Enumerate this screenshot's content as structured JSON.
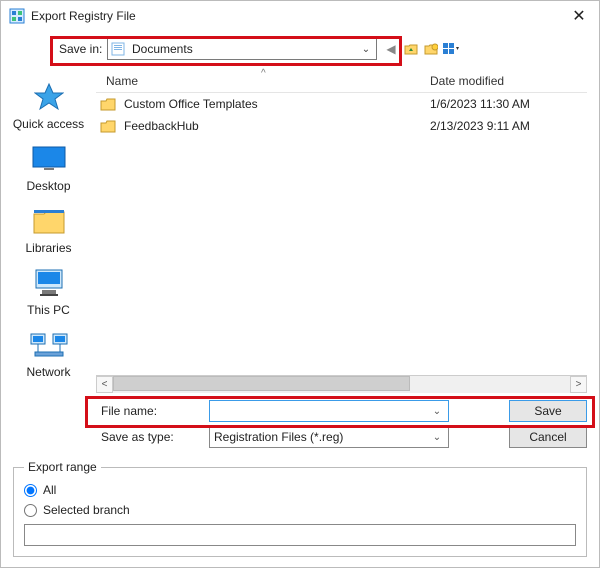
{
  "window": {
    "title": "Export Registry File",
    "close_glyph": "✕"
  },
  "savein": {
    "label": "Save in:",
    "location": "Documents"
  },
  "columns": {
    "name": "Name",
    "date": "Date modified",
    "sort_arrow": "^"
  },
  "files": [
    {
      "name": "Custom Office Templates",
      "date": "1/6/2023 11:30 AM"
    },
    {
      "name": "FeedbackHub",
      "date": "2/13/2023 9:11 AM"
    }
  ],
  "places": {
    "quick": "Quick access",
    "desktop": "Desktop",
    "libraries": "Libraries",
    "thispc": "This PC",
    "network": "Network"
  },
  "bottom": {
    "filename_label": "File name:",
    "filename_value": "",
    "type_label": "Save as type:",
    "type_value": "Registration Files (*.reg)",
    "save": "Save",
    "cancel": "Cancel"
  },
  "export": {
    "legend": "Export range",
    "all": "All",
    "selected": "Selected branch",
    "branch_value": ""
  }
}
